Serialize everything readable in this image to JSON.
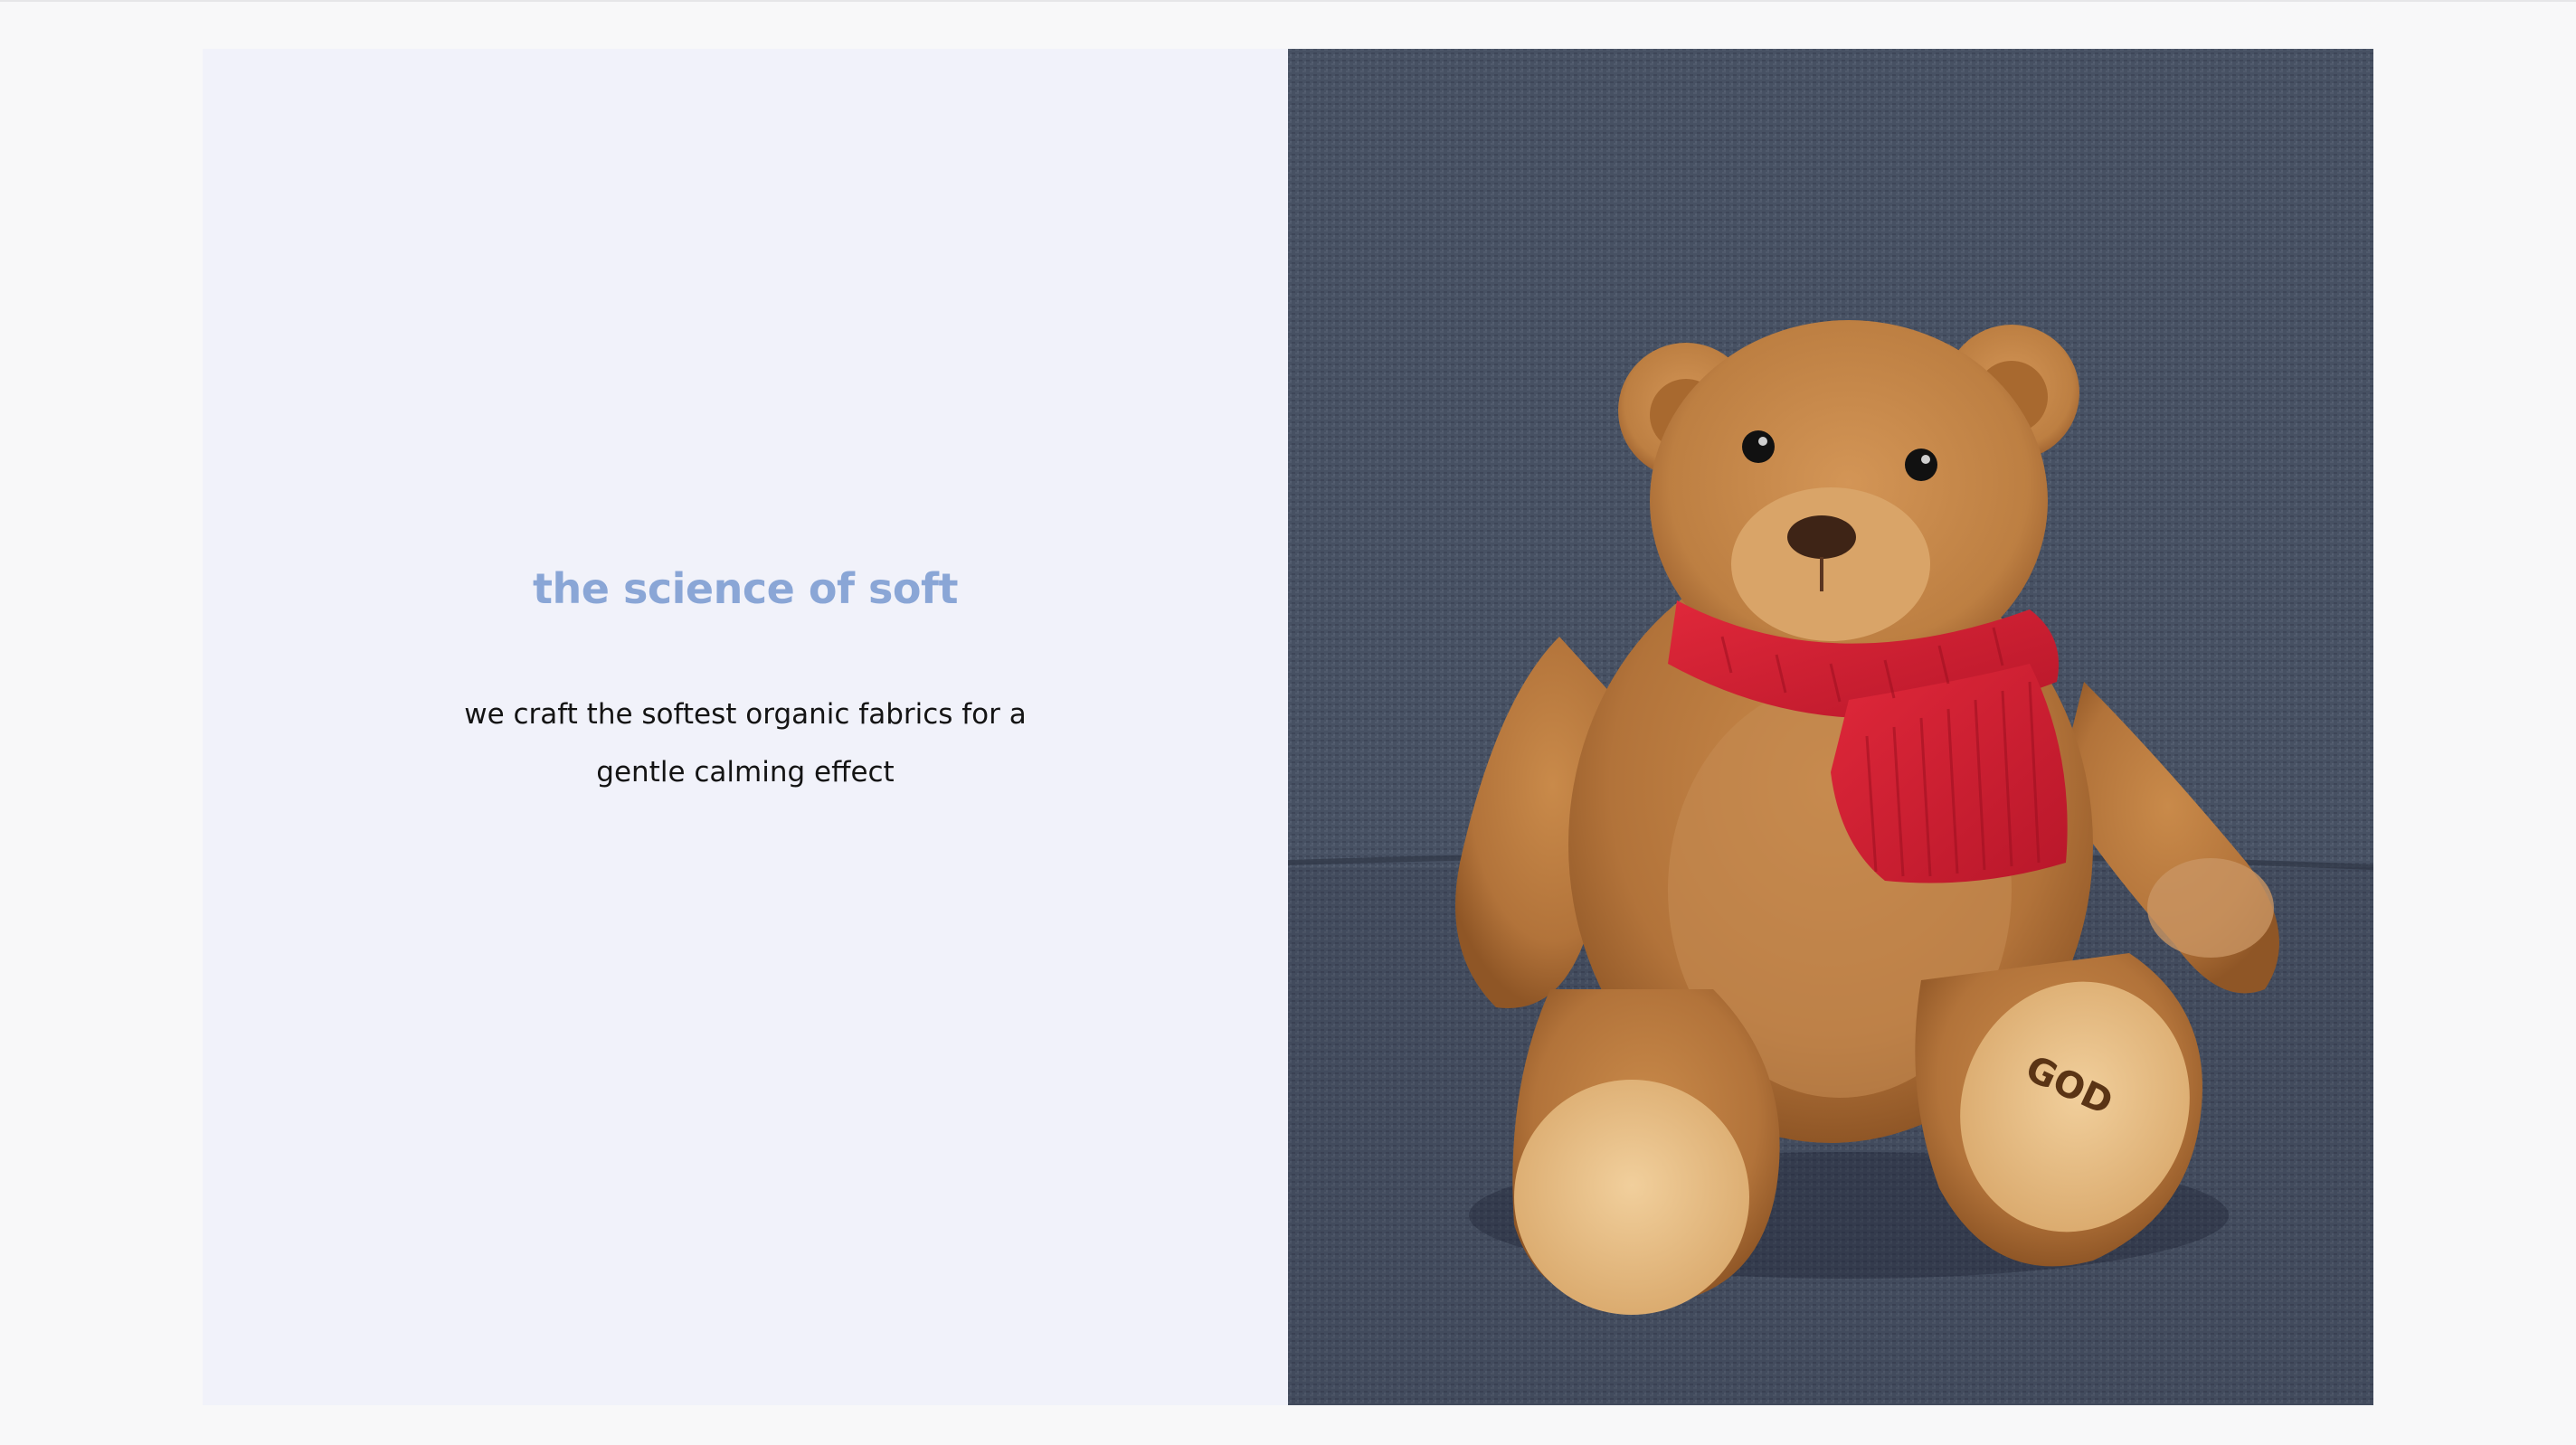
{
  "hero": {
    "headline": "the science of soft",
    "body": "we craft the softest organic fabrics for a gentle calming effect",
    "image": {
      "subject": "teddy-bear-with-red-scarf",
      "paw_print_text": "GOD"
    }
  },
  "colors": {
    "page_background": "#f8f8f9",
    "text_panel_background": "#f1f2fa",
    "headline": "#8aa6d6",
    "body_text": "#141414",
    "sofa": "#4a5466",
    "bear_fur": "#b87a3c",
    "scarf": "#d51f30"
  }
}
